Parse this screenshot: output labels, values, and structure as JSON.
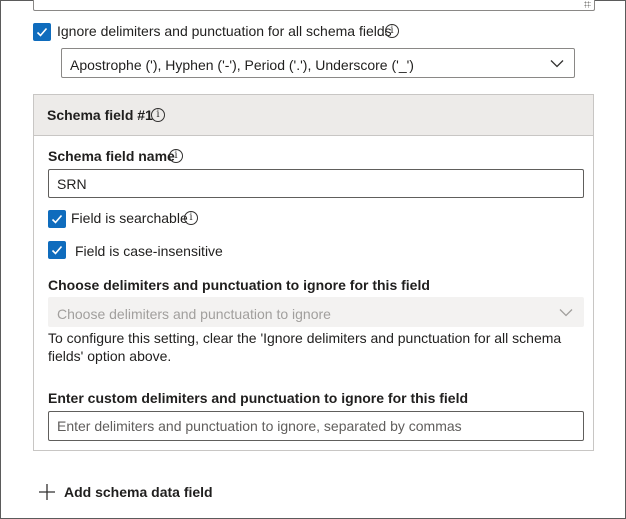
{
  "global_ignore": {
    "checked": true,
    "label": "Ignore delimiters and punctuation for all schema fields",
    "selected_value": "Apostrophe ('), Hyphen ('-'), Period ('.'), Underscore ('_')"
  },
  "schema_field": {
    "header": "Schema field #1",
    "name_label": "Schema field name",
    "name_value": "SRN",
    "searchable_label": "Field is searchable",
    "case_insensitive_label": "Field is case-insensitive",
    "choose_label": "Choose delimiters and punctuation to ignore for this field",
    "choose_placeholder": "Choose delimiters and punctuation to ignore",
    "help_text": "To configure this setting, clear the 'Ignore delimiters and punctuation for all schema fields' option above.",
    "custom_label": "Enter custom delimiters and punctuation to ignore for this field",
    "custom_placeholder": "Enter delimiters and punctuation to ignore, separated by commas"
  },
  "add_button": {
    "label": "Add schema data field"
  },
  "colors": {
    "accent": "#0f6cbd",
    "panel_header_bg": "#edebe9",
    "disabled_bg": "#f3f2f1"
  },
  "icons": {
    "info": "info-icon",
    "check": "checkmark-icon",
    "chevron": "chevron-down-icon",
    "add": "plus-icon"
  }
}
